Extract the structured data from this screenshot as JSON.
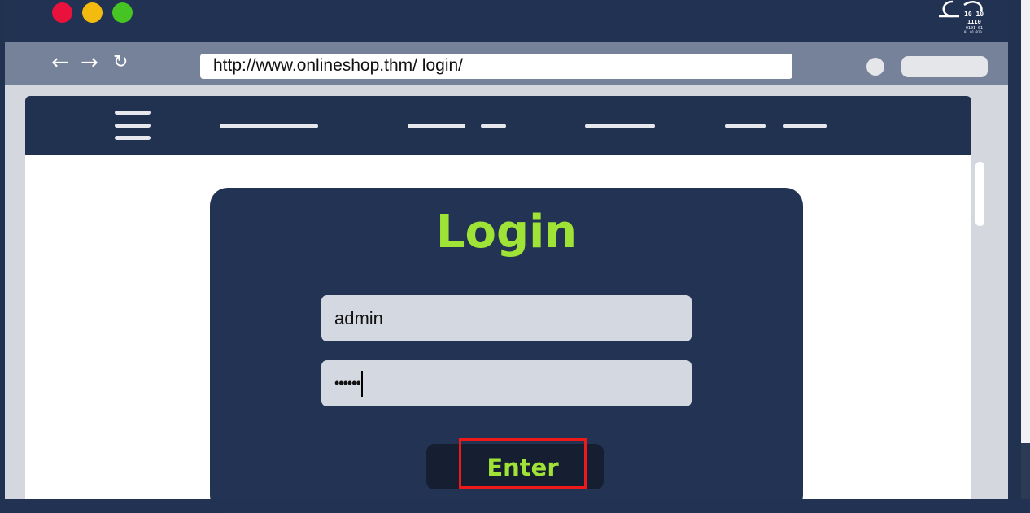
{
  "browser": {
    "url": "http://www.onlineshop.thm/ login/",
    "back_icon": "←",
    "forward_icon": "→",
    "reload_icon": "↻"
  },
  "login": {
    "title": "Login",
    "username_value": "admin",
    "password_value": "••••••",
    "submit_label": "Enter"
  },
  "colors": {
    "accent": "#9ee336",
    "panel": "#223353",
    "highlight": "#ee1a1a"
  }
}
